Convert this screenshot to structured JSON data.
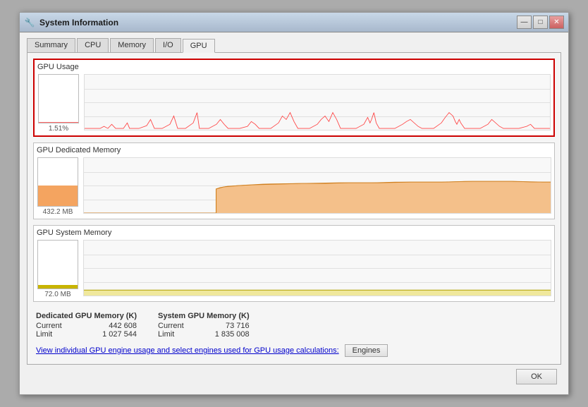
{
  "window": {
    "title": "System Information",
    "icon": "⚙️"
  },
  "tabs": [
    {
      "label": "Summary",
      "active": false
    },
    {
      "label": "CPU",
      "active": false
    },
    {
      "label": "Memory",
      "active": false
    },
    {
      "label": "I/O",
      "active": false
    },
    {
      "label": "GPU",
      "active": true
    }
  ],
  "sections": {
    "gpu_usage": {
      "title": "GPU Usage",
      "gauge_label": "1.51%",
      "highlighted": true
    },
    "dedicated_memory": {
      "title": "GPU Dedicated Memory",
      "gauge_label": "432.2 MB"
    },
    "system_memory": {
      "title": "GPU System Memory",
      "gauge_label": "72.0 MB"
    }
  },
  "stats": {
    "dedicated": {
      "title": "Dedicated GPU Memory (K)",
      "current_label": "Current",
      "current_value": "442 608",
      "limit_label": "Limit",
      "limit_value": "1 027 544"
    },
    "system": {
      "title": "System GPU Memory (K)",
      "current_label": "Current",
      "current_value": "73 716",
      "limit_label": "Limit",
      "limit_value": "1 835 008"
    }
  },
  "engines_text": "View individual GPU engine usage and select engines used for GPU usage calculations:",
  "engines_btn": "Engines",
  "ok_btn": "OK",
  "title_controls": {
    "minimize": "—",
    "maximize": "□",
    "close": "✕"
  }
}
